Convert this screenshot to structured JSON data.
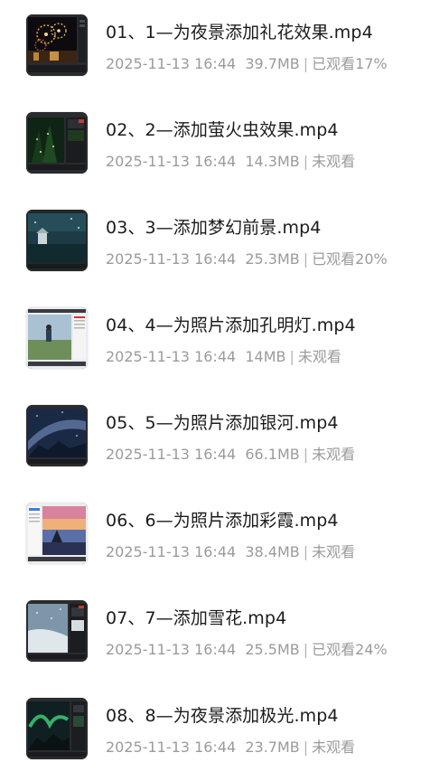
{
  "files": [
    {
      "title": "01、1—为夜景添加礼花效果.mp4",
      "date": "2025-11-13 16:44",
      "size": "39.7MB",
      "status": "已观看17%",
      "thumbnail": "fireworks-night-scene"
    },
    {
      "title": "02、2—添加萤火虫效果.mp4",
      "date": "2025-11-13 16:44",
      "size": "14.3MB",
      "status": "未观看",
      "thumbnail": "firefly-forest"
    },
    {
      "title": "03、3—添加梦幻前景.mp4",
      "date": "2025-11-13 16:44",
      "size": "25.3MB",
      "status": "已观看20%",
      "thumbnail": "dreamy-foreground"
    },
    {
      "title": "04、4—为照片添加孔明灯.mp4",
      "date": "2025-11-13 16:44",
      "size": "14MB",
      "status": "未观看",
      "thumbnail": "sky-lantern-photo"
    },
    {
      "title": "05、5—为照片添加银河.mp4",
      "date": "2025-11-13 16:44",
      "size": "66.1MB",
      "status": "未观看",
      "thumbnail": "milky-way-photo"
    },
    {
      "title": "06、6—为照片添加彩霞.mp4",
      "date": "2025-11-13 16:44",
      "size": "38.4MB",
      "status": "未观看",
      "thumbnail": "sunset-clouds-photo"
    },
    {
      "title": "07、7—添加雪花.mp4",
      "date": "2025-11-13 16:44",
      "size": "25.5MB",
      "status": "已观看24%",
      "thumbnail": "snowflakes-scene"
    },
    {
      "title": "08、8—为夜景添加极光.mp4",
      "date": "2025-11-13 16:44",
      "size": "23.7MB",
      "status": "未观看",
      "thumbnail": "aurora-night-scene"
    }
  ]
}
